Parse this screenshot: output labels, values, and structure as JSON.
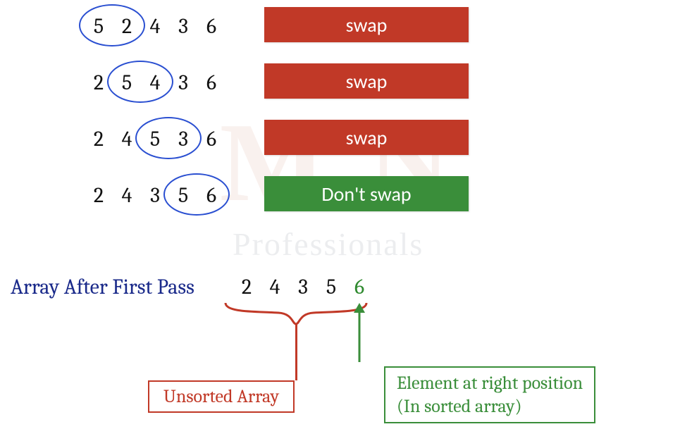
{
  "rows": [
    {
      "nums": [
        "5",
        "2",
        "4",
        "3",
        "6"
      ],
      "circle_start": 0,
      "circle_end": 1,
      "action": "swap",
      "action_color": "red"
    },
    {
      "nums": [
        "2",
        "5",
        "4",
        "3",
        "6"
      ],
      "circle_start": 1,
      "circle_end": 2,
      "action": "swap",
      "action_color": "red"
    },
    {
      "nums": [
        "2",
        "4",
        "5",
        "3",
        "6"
      ],
      "circle_start": 2,
      "circle_end": 3,
      "action": "swap",
      "action_color": "red"
    },
    {
      "nums": [
        "2",
        "4",
        "3",
        "5",
        "6"
      ],
      "circle_start": 3,
      "circle_end": 4,
      "action": "Don't swap",
      "action_color": "green"
    }
  ],
  "pass_label": "Array After First Pass",
  "result": {
    "nums": [
      "2",
      "4",
      "3",
      "5",
      "6"
    ],
    "sorted_from_index": 4
  },
  "unsorted_label": "Unsorted Array",
  "sorted_label_line1": "Element at right position",
  "sorted_label_line2": "(In sorted array)",
  "watermark_big": "M  N",
  "watermark_sub": "Professionals",
  "colors": {
    "red": "#c13927",
    "green": "#3a8e3a",
    "blue_circle": "#2a4fd1",
    "label_blue": "#1a2a8a"
  }
}
